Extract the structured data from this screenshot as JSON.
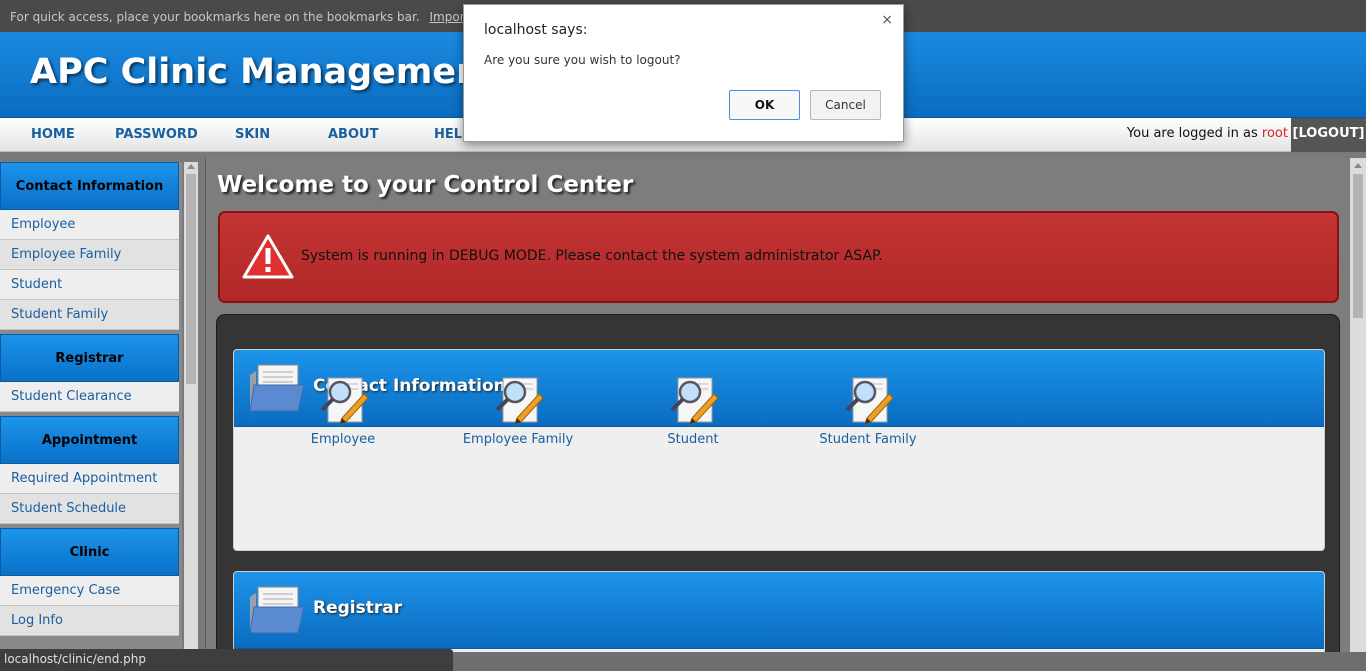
{
  "browser": {
    "bookmarks_hint": "For quick access, place your bookmarks here on the bookmarks bar.",
    "import_link": "Import bookmarks now..."
  },
  "header": {
    "title": "APC Clinic Management System"
  },
  "nav": {
    "items": [
      "HOME",
      "PASSWORD",
      "SKIN",
      "ABOUT",
      "HELP"
    ],
    "login_prefix": "You are logged in as",
    "username": "root",
    "logout": "[LOGOUT]"
  },
  "sidebar": {
    "groups": [
      {
        "title": "Contact Information",
        "items": [
          "Employee",
          "Employee Family",
          "Student",
          "Student Family"
        ]
      },
      {
        "title": "Registrar",
        "items": [
          "Student Clearance"
        ]
      },
      {
        "title": "Appointment",
        "items": [
          "Required Appointment",
          "Student Schedule"
        ]
      },
      {
        "title": "Clinic",
        "items": [
          "Emergency Case",
          "Log Info"
        ]
      }
    ]
  },
  "main": {
    "title": "Welcome to your Control Center",
    "alert": "System is running in DEBUG MODE. Please contact the system administrator ASAP.",
    "sections": [
      {
        "title": "Contact Information",
        "tiles": [
          "Employee",
          "Employee Family",
          "Student",
          "Student Family"
        ]
      },
      {
        "title": "Registrar",
        "tiles": []
      }
    ]
  },
  "status_bar": {
    "url": "localhost/clinic/end.php"
  },
  "dialog": {
    "title": "localhost says:",
    "message": "Are you sure you wish to logout?",
    "ok": "OK",
    "cancel": "Cancel",
    "close": "×"
  },
  "colors": {
    "accent_blue": "#0a78d4",
    "alert_red": "#c43434",
    "username_red": "#e02020",
    "link_blue": "#1a5fa0"
  },
  "icons": [
    "folder-icon",
    "search-edit-icon",
    "warning-icon",
    "close-icon"
  ]
}
